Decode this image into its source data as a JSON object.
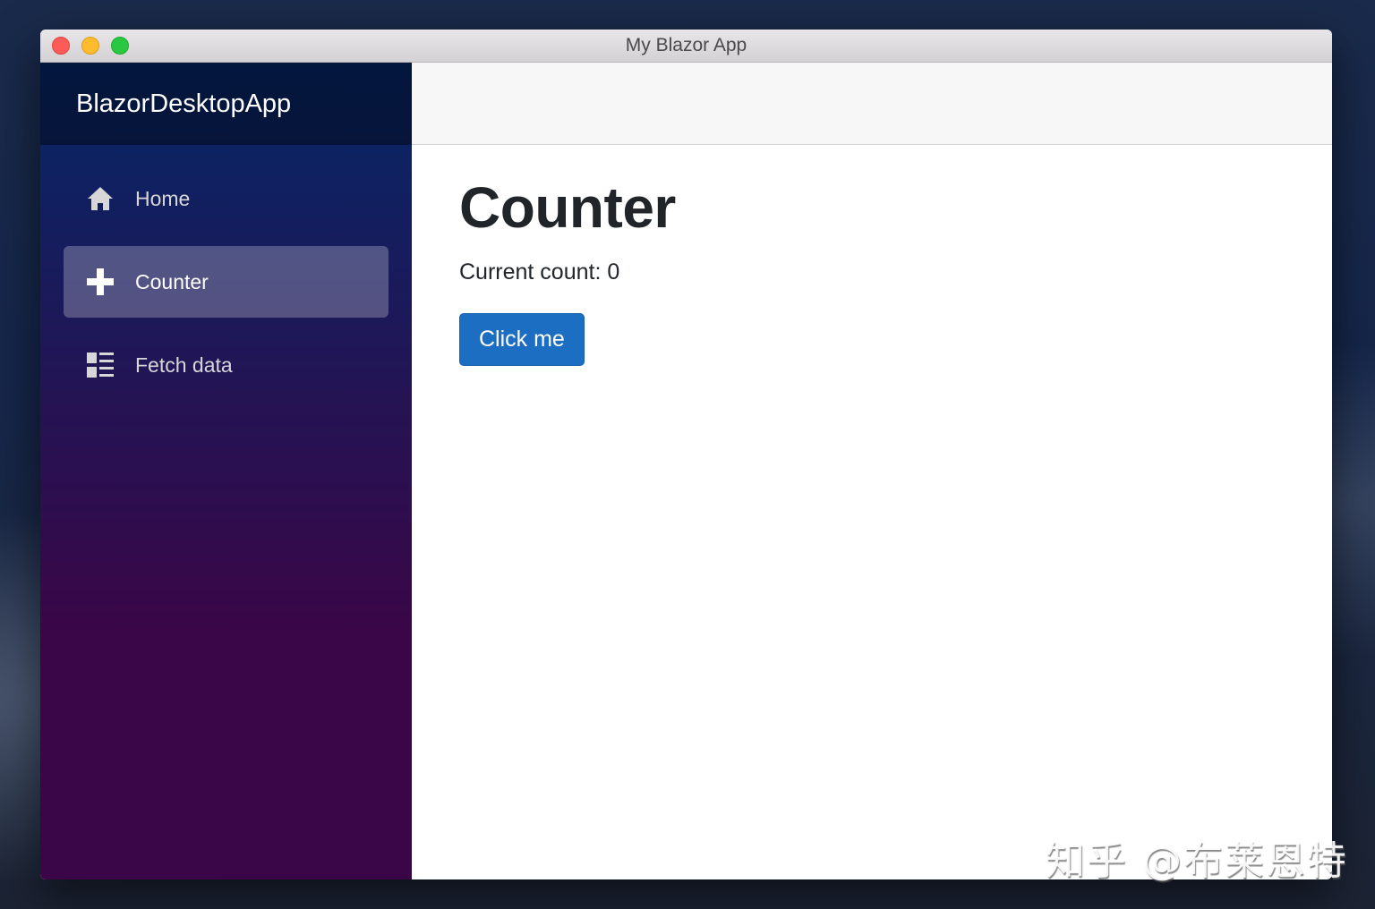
{
  "window": {
    "title": "My Blazor App",
    "controls": [
      "close",
      "minimize",
      "maximize"
    ]
  },
  "sidebar": {
    "brand": "BlazorDesktopApp",
    "items": [
      {
        "label": "Home",
        "icon": "home-icon",
        "active": false
      },
      {
        "label": "Counter",
        "icon": "plus-icon",
        "active": true
      },
      {
        "label": "Fetch data",
        "icon": "list-rich-icon",
        "active": false
      }
    ]
  },
  "main": {
    "title": "Counter",
    "count_label": "Current count: 0",
    "count_value": 0,
    "button_label": "Click me"
  },
  "colors": {
    "sidebar_top": "#052767",
    "sidebar_bottom": "#3a0647",
    "button_primary": "#1b6ec2",
    "text_primary": "#212529"
  },
  "watermark": "知乎 @布莱恩特"
}
